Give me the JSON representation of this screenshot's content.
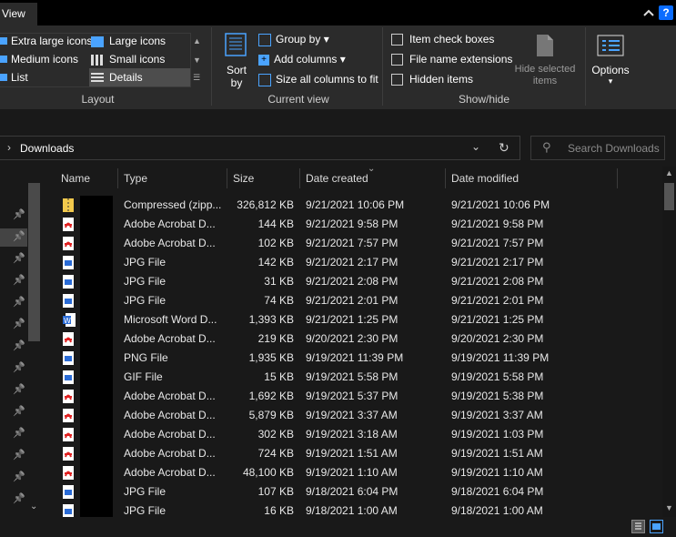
{
  "tabbar": {
    "tab_view": "View"
  },
  "ribbon": {
    "layout": {
      "label": "Layout",
      "items": [
        "Extra large icons",
        "Medium icons",
        "List",
        "Large icons",
        "Small icons",
        "Details"
      ]
    },
    "current_view": {
      "label": "Current view",
      "sort_by": "Sort by",
      "group_by": "Group by",
      "add_columns": "Add columns",
      "size_all": "Size all columns to fit"
    },
    "show_hide": {
      "label": "Show/hide",
      "item_check_boxes": "Item check boxes",
      "file_name_extensions": "File name extensions",
      "hidden_items": "Hidden items",
      "hide_selected_items": "Hide selected items"
    },
    "options": {
      "label": "Options"
    }
  },
  "address": {
    "path": "Downloads",
    "search_placeholder": "Search Downloads"
  },
  "columns": {
    "name": "Name",
    "type": "Type",
    "size": "Size",
    "date_created": "Date created",
    "date_modified": "Date modified"
  },
  "files": [
    {
      "icon": "zip",
      "type": "Compressed (zipp...",
      "size": "326,812 KB",
      "created": "9/21/2021 10:06 PM",
      "modified": "9/21/2021 10:06 PM"
    },
    {
      "icon": "pdf",
      "type": "Adobe Acrobat D...",
      "size": "144 KB",
      "created": "9/21/2021 9:58 PM",
      "modified": "9/21/2021 9:58 PM"
    },
    {
      "icon": "pdf",
      "type": "Adobe Acrobat D...",
      "size": "102 KB",
      "created": "9/21/2021 7:57 PM",
      "modified": "9/21/2021 7:57 PM"
    },
    {
      "icon": "img",
      "type": "JPG File",
      "size": "142 KB",
      "created": "9/21/2021 2:17 PM",
      "modified": "9/21/2021 2:17 PM"
    },
    {
      "icon": "img",
      "type": "JPG File",
      "size": "31 KB",
      "created": "9/21/2021 2:08 PM",
      "modified": "9/21/2021 2:08 PM"
    },
    {
      "icon": "img",
      "type": "JPG File",
      "size": "74 KB",
      "created": "9/21/2021 2:01 PM",
      "modified": "9/21/2021 2:01 PM"
    },
    {
      "icon": "word",
      "type": "Microsoft Word D...",
      "size": "1,393 KB",
      "created": "9/21/2021 1:25 PM",
      "modified": "9/21/2021 1:25 PM"
    },
    {
      "icon": "pdf",
      "type": "Adobe Acrobat D...",
      "size": "219 KB",
      "created": "9/20/2021 2:30 PM",
      "modified": "9/20/2021 2:30 PM"
    },
    {
      "icon": "img",
      "type": "PNG File",
      "size": "1,935 KB",
      "created": "9/19/2021 11:39 PM",
      "modified": "9/19/2021 11:39 PM"
    },
    {
      "icon": "img",
      "type": "GIF File",
      "size": "15 KB",
      "created": "9/19/2021 5:58 PM",
      "modified": "9/19/2021 5:58 PM"
    },
    {
      "icon": "pdf",
      "type": "Adobe Acrobat D...",
      "size": "1,692 KB",
      "created": "9/19/2021 5:37 PM",
      "modified": "9/19/2021 5:38 PM"
    },
    {
      "icon": "pdf",
      "type": "Adobe Acrobat D...",
      "size": "5,879 KB",
      "created": "9/19/2021 3:37 AM",
      "modified": "9/19/2021 3:37 AM"
    },
    {
      "icon": "pdf",
      "type": "Adobe Acrobat D...",
      "size": "302 KB",
      "created": "9/19/2021 3:18 AM",
      "modified": "9/19/2021 1:03 PM"
    },
    {
      "icon": "pdf",
      "type": "Adobe Acrobat D...",
      "size": "724 KB",
      "created": "9/19/2021 1:51 AM",
      "modified": "9/19/2021 1:51 AM"
    },
    {
      "icon": "pdf",
      "type": "Adobe Acrobat D...",
      "size": "48,100 KB",
      "created": "9/19/2021 1:10 AM",
      "modified": "9/19/2021 1:10 AM"
    },
    {
      "icon": "img",
      "type": "JPG File",
      "size": "107 KB",
      "created": "9/18/2021 6:04 PM",
      "modified": "9/18/2021 6:04 PM"
    },
    {
      "icon": "img",
      "type": "JPG File",
      "size": "16 KB",
      "created": "9/18/2021 1:00 AM",
      "modified": "9/18/2021 1:00 AM"
    }
  ],
  "colors": {
    "accent": "#0a6cff",
    "pdf_red": "#e02020",
    "word_blue": "#2b6cd6",
    "zip_yellow": "#f2c94c"
  }
}
